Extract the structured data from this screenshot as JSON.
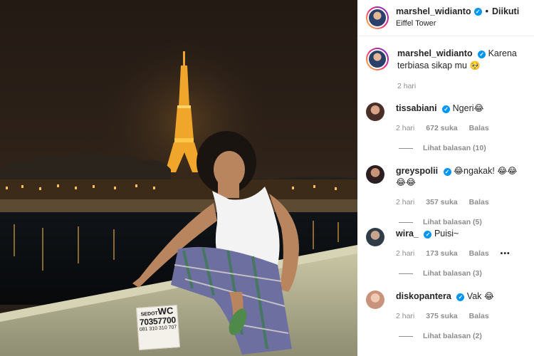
{
  "post": {
    "author": "marshel_widianto",
    "follow_status": "Diikuti",
    "location": "Eiffel Tower",
    "caption_text": "Karena terbiasa sikap mu",
    "caption_emoji": "🥺",
    "caption_time": "2 hari",
    "sign": {
      "line1_prefix": "SEDOT",
      "line1_big": "WC",
      "line2": "",
      "phone_main": "70357700",
      "phone_alt": "081 310 310 707"
    }
  },
  "labels": {
    "likes_suffix": "suka",
    "reply": "Balas",
    "more": "•••"
  },
  "comments": [
    {
      "user": "tissabiani",
      "text": "Ngeri",
      "emoji": "😂",
      "time": "2 hari",
      "likes": "672 suka",
      "replies": "Lihat balasan (10)",
      "avatar_color": "#6b4a3e"
    },
    {
      "user": "greyspolii",
      "text": "ngakak!",
      "emoji_before": "😂",
      "emoji": "😂😂😂😂",
      "time": "2 hari",
      "likes": "357 suka",
      "replies": "Lihat balasan (5)",
      "avatar_color": "#3a2b2e"
    },
    {
      "user": "wira_",
      "text": "Puisi~",
      "emoji": "",
      "time": "2 hari",
      "likes": "173 suka",
      "replies": "Lihat balasan (3)",
      "avatar_color": "#2f3c48"
    },
    {
      "user": "diskopantera",
      "text": "Vak",
      "emoji": "😂",
      "time": "2 hari",
      "likes": "375 suka",
      "replies": "Lihat balasan (2)",
      "avatar_color": "#c9927a"
    }
  ]
}
